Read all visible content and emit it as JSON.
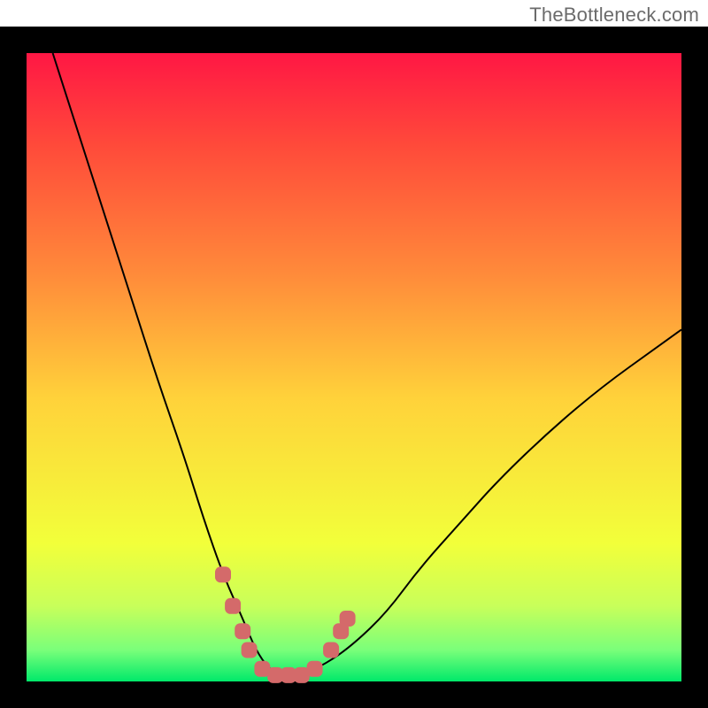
{
  "watermark": "TheBottleneck.com",
  "chart_data": {
    "type": "line",
    "title": "",
    "xlabel": "",
    "ylabel": "",
    "xlim": [
      0,
      100
    ],
    "ylim": [
      0,
      100
    ],
    "grid": false,
    "legend": false,
    "background_gradient": {
      "direction": "vertical",
      "stops": [
        {
          "pos": 0.0,
          "color": "#ff1744"
        },
        {
          "pos": 0.15,
          "color": "#ff4b3a"
        },
        {
          "pos": 0.35,
          "color": "#ff8a3a"
        },
        {
          "pos": 0.55,
          "color": "#ffd23a"
        },
        {
          "pos": 0.78,
          "color": "#f2ff3a"
        },
        {
          "pos": 0.88,
          "color": "#c8ff5a"
        },
        {
          "pos": 0.95,
          "color": "#7aff7a"
        },
        {
          "pos": 1.0,
          "color": "#00e96a"
        }
      ]
    },
    "series": [
      {
        "name": "bottleneck-curve",
        "color": "#000000",
        "x": [
          4,
          8,
          12,
          16,
          20,
          24,
          27,
          30,
          33,
          35,
          37,
          39,
          42,
          46,
          50,
          55,
          60,
          66,
          72,
          80,
          88,
          96,
          100
        ],
        "y": [
          100,
          87,
          74,
          61,
          48,
          36,
          26,
          17,
          10,
          5,
          2,
          1,
          1,
          3,
          6,
          11,
          18,
          25,
          32,
          40,
          47,
          53,
          56
        ]
      }
    ],
    "markers": [
      {
        "name": "highlight-dots",
        "shape": "rounded-square",
        "size": 18,
        "color": "#d46a6a",
        "points": [
          {
            "x": 30,
            "y": 17
          },
          {
            "x": 31.5,
            "y": 12
          },
          {
            "x": 33,
            "y": 8
          },
          {
            "x": 34,
            "y": 5
          },
          {
            "x": 36,
            "y": 2
          },
          {
            "x": 38,
            "y": 1
          },
          {
            "x": 40,
            "y": 1
          },
          {
            "x": 42,
            "y": 1
          },
          {
            "x": 44,
            "y": 2
          },
          {
            "x": 46.5,
            "y": 5
          },
          {
            "x": 48,
            "y": 8
          },
          {
            "x": 49,
            "y": 10
          }
        ]
      }
    ],
    "frame": {
      "inset": 30,
      "stroke": "#000000",
      "stroke_width": 30
    }
  }
}
